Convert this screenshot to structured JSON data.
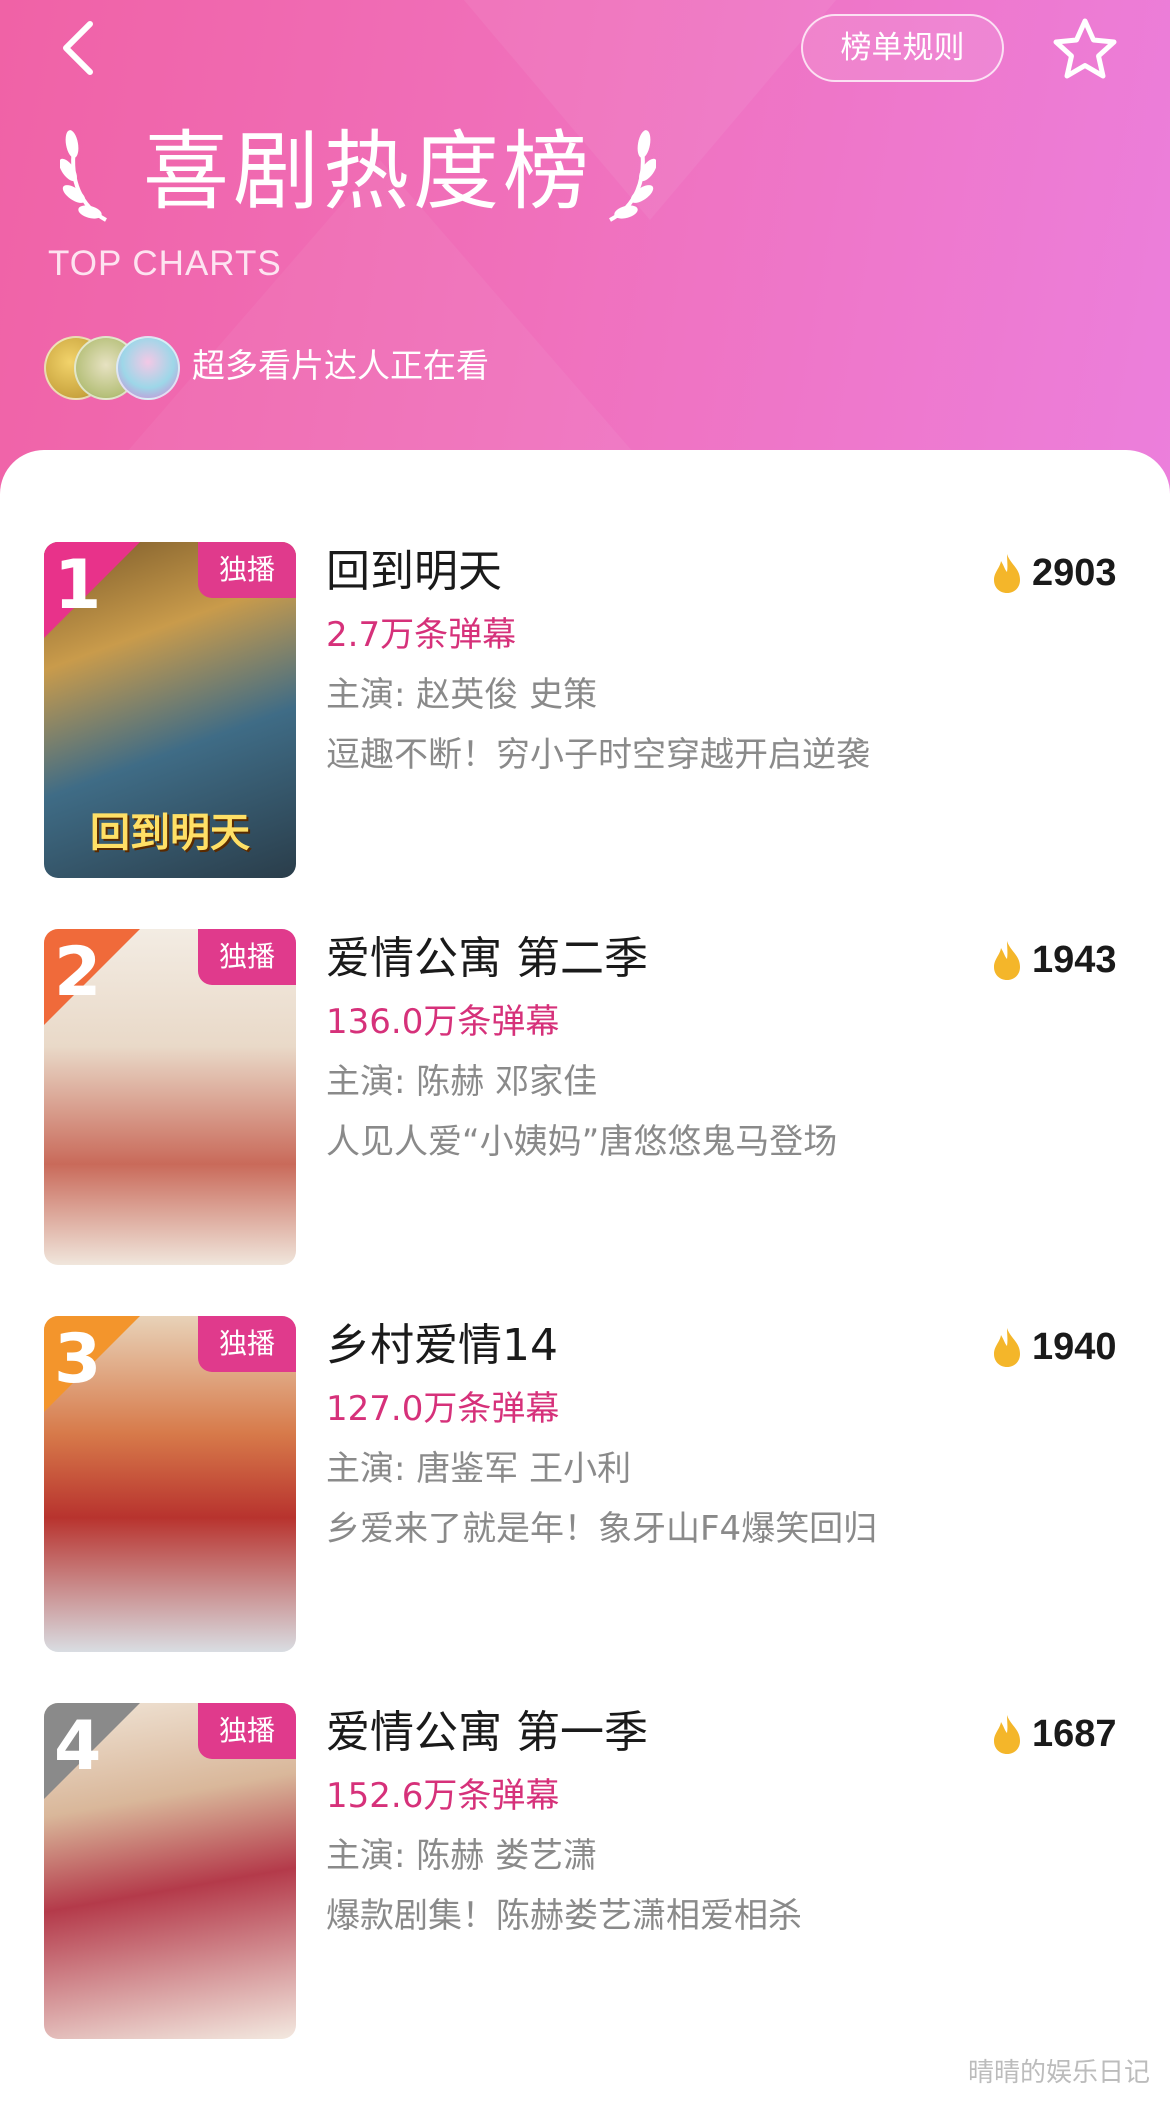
{
  "header": {
    "rules_label": "榜单规则",
    "title": "喜剧热度榜",
    "subtitle": "TOP CHARTS",
    "viewers_text": "超多看片达人正在看",
    "back_icon": "chevron-left-icon",
    "star_icon": "star-outline-icon"
  },
  "colors": {
    "header_gradient_start": "#f062a6",
    "header_gradient_end": "#ec7fdc",
    "danmu_text": "#d6317a",
    "exclusive_badge": "#e03a8c",
    "flame": "#f4b62a"
  },
  "items": [
    {
      "rank": "1",
      "badge": "独播",
      "title": "回到明天",
      "danmu": "2.7万条弹幕",
      "cast": "主演: 赵英俊 史策",
      "desc": "逗趣不断！穷小子时空穿越开启逆袭",
      "heat": "2903",
      "poster_caption": "回到明天"
    },
    {
      "rank": "2",
      "badge": "独播",
      "title": "爱情公寓 第二季",
      "danmu": "136.0万条弹幕",
      "cast": "主演: 陈赫 邓家佳",
      "desc": "人见人爱“小姨妈”唐悠悠鬼马登场",
      "heat": "1943",
      "poster_caption": ""
    },
    {
      "rank": "3",
      "badge": "独播",
      "title": "乡村爱情14",
      "danmu": "127.0万条弹幕",
      "cast": "主演: 唐鉴军 王小利",
      "desc": "乡爱来了就是年！象牙山F4爆笑回归",
      "heat": "1940",
      "poster_caption": ""
    },
    {
      "rank": "4",
      "badge": "独播",
      "title": "爱情公寓 第一季",
      "danmu": "152.6万条弹幕",
      "cast": "主演: 陈赫 娄艺潇",
      "desc": "爆款剧集！陈赫娄艺潇相爱相杀",
      "heat": "1687",
      "poster_caption": ""
    }
  ],
  "watermark": "晴晴的娱乐日记"
}
